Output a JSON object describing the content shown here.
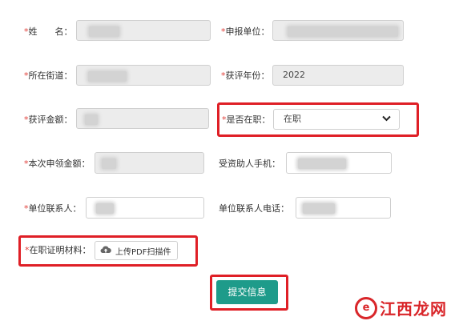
{
  "form": {
    "required_mark": "*",
    "name": {
      "label": "姓　　名："
    },
    "org": {
      "label": "申报单位："
    },
    "street": {
      "label": "所在街道："
    },
    "year": {
      "label": "获评年份：",
      "value": "2022"
    },
    "amount": {
      "label": "获评金额："
    },
    "employed": {
      "label": "是否在职：",
      "selected": "在职"
    },
    "claim_amount": {
      "label": "本次申领金额："
    },
    "phone": {
      "label": "受资助人手机："
    },
    "contact": {
      "label": "单位联系人："
    },
    "contact_phone": {
      "label": "单位联系人电话："
    },
    "proof": {
      "label": "在职证明材料：",
      "upload_label": "上传PDF扫描件"
    },
    "submit_label": "提交信息"
  },
  "watermark": {
    "text": "江西龙网"
  },
  "colors": {
    "required": "#e0403a",
    "highlight": "#df1f26",
    "submit": "#1e9b8a"
  },
  "icons": [
    "upload-cloud-icon",
    "chevron-down-icon"
  ]
}
